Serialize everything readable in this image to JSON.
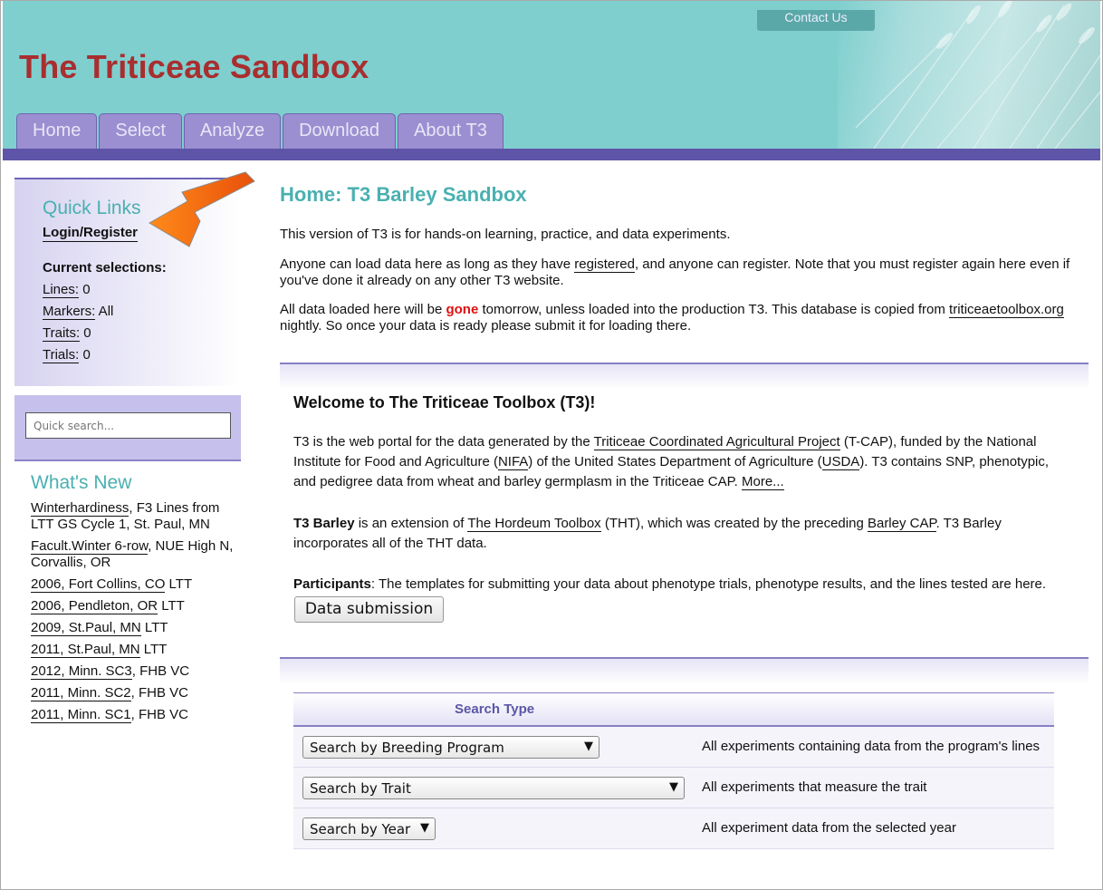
{
  "header": {
    "contact_label": "Contact Us",
    "site_title": "The Triticeae Sandbox",
    "nav": [
      "Home",
      "Select",
      "Analyze",
      "Download",
      "About T3"
    ]
  },
  "sidebar": {
    "quick_links_title": "Quick Links",
    "login_label": "Login/Register",
    "current_selections_label": "Current selections:",
    "selections": [
      {
        "label": "Lines:",
        "value": " 0"
      },
      {
        "label": "Markers:",
        "value": " All"
      },
      {
        "label": "Traits:",
        "value": " 0"
      },
      {
        "label": "Trials:",
        "value": " 0"
      }
    ],
    "quick_search_placeholder": "Quick search...",
    "whats_new_title": "What's New",
    "news": [
      {
        "link": "Winterhardiness",
        "rest": ", F3 Lines from LTT GS Cycle 1, St. Paul, MN"
      },
      {
        "link": "Facult.Winter 6-row",
        "rest": ", NUE High N, Corvallis, OR"
      },
      {
        "link": "2006, Fort Collins, CO",
        "rest": " LTT"
      },
      {
        "link": "2006, Pendleton, OR",
        "rest": " LTT"
      },
      {
        "link": "2009, St.Paul, MN",
        "rest": " LTT"
      },
      {
        "link": "2011, St.Paul, MN",
        "rest": " LTT"
      },
      {
        "link": "2012, Minn. SC3",
        "rest": ", FHB VC"
      },
      {
        "link": "2011, Minn. SC2",
        "rest": ", FHB VC"
      },
      {
        "link": "2011, Minn. SC1",
        "rest": ", FHB VC"
      }
    ]
  },
  "main": {
    "title": "Home: T3 Barley Sandbox",
    "p1": "This version of T3 is for hands-on learning, practice, and data experiments.",
    "p2_a": "Anyone can load data here as long as they have ",
    "p2_link": "registered",
    "p2_b": ", and anyone can register. Note that you must register again here even if you've done it already on any other T3 website.",
    "p3_a": "All data loaded here will be ",
    "p3_gone": "gone",
    "p3_b": " tomorrow, unless loaded into the production T3. This database is copied from ",
    "p3_link": "triticeaetoolbox.org",
    "p3_c": " nightly. So once your data is ready please submit it for loading there.",
    "welcome_title": "Welcome to The Triticeae Toolbox (T3)!",
    "w1_a": "T3 is the web portal for the data generated by the ",
    "w1_link1": "Triticeae Coordinated Agricultural Project",
    "w1_b": " (T-CAP), funded by the National Institute for Food and Agriculture (",
    "w1_link2": "NIFA",
    "w1_c": ") of the United States Department of Agriculture (",
    "w1_link3": "USDA",
    "w1_d": "). T3 contains SNP, phenotypic, and pedigree data from wheat and barley germplasm in the Triticeae CAP. ",
    "w1_more": "More...",
    "w2_bold": "T3 Barley",
    "w2_a": " is an extension of ",
    "w2_link1": "The Hordeum Toolbox",
    "w2_b": " (THT), which was created by the preceding ",
    "w2_link2": "Barley CAP",
    "w2_c": ". T3 Barley incorporates all of the THT data.",
    "w3_bold": "Participants",
    "w3_a": ": The templates for submitting your data about phenotype trials, phenotype results, and the lines tested are here.",
    "data_submission_label": "Data submission"
  },
  "search_table": {
    "header": "Search Type",
    "rows": [
      {
        "select": "Search by Breeding Program",
        "desc": "All experiments containing data from the program's lines"
      },
      {
        "select": "Search by Trait",
        "desc": "All experiments that measure the trait"
      },
      {
        "select": "Search by Year",
        "desc": "All experiment data from the selected year"
      }
    ]
  },
  "colors": {
    "title_red": "#a92e2e",
    "teal": "#4ab0b0",
    "nav_purple": "#9b8fd1",
    "bar_purple": "#5e54a8",
    "arrow_orange": "#f06a10"
  },
  "icons": {
    "pointer": "orange-arrow-icon",
    "dropdown": "triangle-down-icon"
  }
}
